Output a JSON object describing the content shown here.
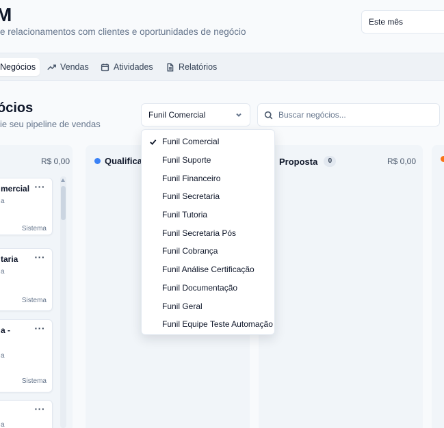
{
  "header": {
    "title": "M",
    "subtitle": "e relacionamentos com clientes e oportunidades de negócio",
    "period_select": "Este mês"
  },
  "nav": {
    "items": [
      {
        "label": "Negócios",
        "icon": "briefcase-icon",
        "active": true
      },
      {
        "label": "Vendas",
        "icon": "trending-up-icon"
      },
      {
        "label": "Atividades",
        "icon": "calendar-icon"
      },
      {
        "label": "Relatórios",
        "icon": "file-text-icon"
      }
    ]
  },
  "page": {
    "title": "ócios",
    "subtitle": "ie seu pipeline de vendas"
  },
  "funnel_select": {
    "value": "Funil Comercial"
  },
  "search": {
    "placeholder": "Buscar negócios..."
  },
  "columns": [
    {
      "name": "",
      "value": "R$ 0,00",
      "color": ""
    },
    {
      "name": "Qualifica",
      "color": "#3b82f6"
    },
    {
      "name": "Proposta",
      "count": "0",
      "value": "R$ 0,00"
    },
    {
      "name": "",
      "color": "#f97316"
    }
  ],
  "cards": [
    {
      "title": "mercial",
      "sub": "a",
      "owner": "Sistema",
      "more": "···"
    },
    {
      "title": "taria",
      "sub": "a",
      "owner": "Sistema",
      "more": "···"
    },
    {
      "title": "a -",
      "sub": "a",
      "owner": "Sistema",
      "more": "···"
    },
    {
      "title": "",
      "sub": "a",
      "owner": "",
      "more": "···"
    }
  ],
  "dropdown": {
    "options": [
      {
        "label": "Funil Comercial",
        "selected": true
      },
      {
        "label": "Funil Suporte"
      },
      {
        "label": "Funil Financeiro"
      },
      {
        "label": "Funil Secretaria"
      },
      {
        "label": "Funil Tutoria"
      },
      {
        "label": "Funil Secretaria Pós"
      },
      {
        "label": "Funil Cobrança"
      },
      {
        "label": "Funil Análise Certificação"
      },
      {
        "label": "Funil Documentação"
      },
      {
        "label": "Funil Geral"
      },
      {
        "label": "Funil Equipe Teste Automação"
      }
    ]
  },
  "colors": {
    "qualifica_dot": "#3b82f6",
    "next_column_dot": "#f97316",
    "background": "#f8fafc",
    "nav_background": "#eef2f6"
  }
}
